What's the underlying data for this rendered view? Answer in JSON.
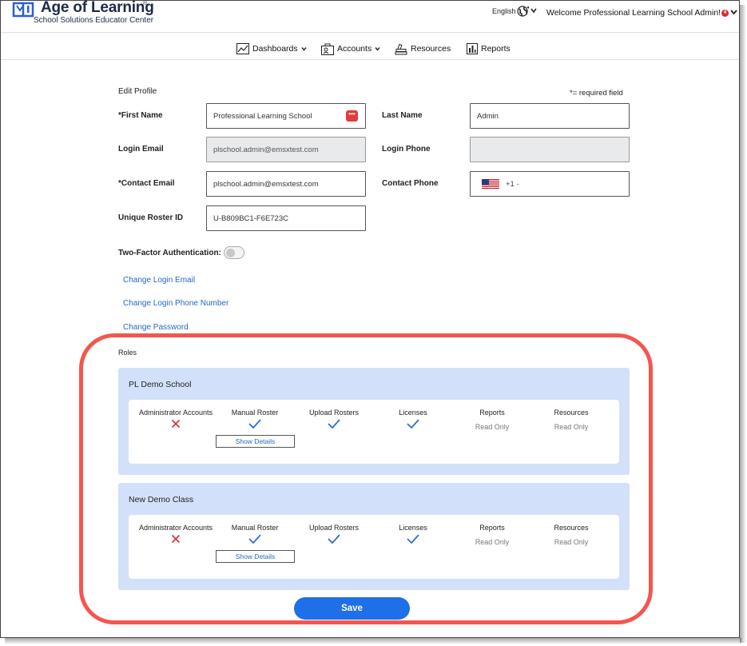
{
  "header": {
    "logo_title": "Age of Learning",
    "logo_reg": "®",
    "logo_subtitle": "School Solutions Educator Center",
    "language": "English",
    "welcome": "Welcome Professional Learning School Admin!",
    "notification_count": "4"
  },
  "nav": {
    "dashboards": "Dashboards",
    "accounts": "Accounts",
    "resources": "Resources",
    "reports": "Reports"
  },
  "profile": {
    "heading": "Edit Profile",
    "required_note": "*= required field",
    "first_name_label": "*First Name",
    "first_name_value": "Professional Learning School",
    "last_name_label": "Last Name",
    "last_name_value": "Admin",
    "login_email_label": "Login Email",
    "login_email_value": "plschool.admin@emsxtest.com",
    "login_phone_label": "Login Phone",
    "login_phone_value": "",
    "contact_email_label": "*Contact Email",
    "contact_email_value": "plschool.admin@emsxtest.com",
    "contact_phone_label": "Contact Phone",
    "contact_phone_code": "+1 -",
    "roster_id_label": "Unique Roster ID",
    "roster_id_value": "U-B809BC1-F6E723C",
    "two_factor_label": "Two-Factor Authentication:",
    "two_factor_enabled": false
  },
  "links": {
    "change_login_email": "Change Login Email",
    "change_login_phone": "Change Login Phone Number",
    "change_password": "Change Password"
  },
  "roles": {
    "heading": "Roles",
    "columns": [
      "Administrator Accounts",
      "Manual Roster",
      "Upload Rosters",
      "Licenses",
      "Reports",
      "Resources"
    ],
    "show_details": "Show Details",
    "entries": [
      {
        "name": "PL Demo School",
        "administrator_accounts": "no",
        "manual_roster": "yes",
        "upload_rosters": "yes",
        "licenses": "yes",
        "reports": "Read Only",
        "resources": "Read Only"
      },
      {
        "name": "New Demo Class",
        "administrator_accounts": "no",
        "manual_roster": "yes",
        "upload_rosters": "yes",
        "licenses": "yes",
        "reports": "Read Only",
        "resources": "Read Only"
      }
    ]
  },
  "actions": {
    "save": "Save"
  },
  "colors": {
    "brand_navy": "#1d2a4b",
    "link_blue": "#2469c4",
    "primary_button": "#1f6fe8",
    "role_background": "#d2e1f9",
    "check_blue": "#2a6fd6",
    "cross_red": "#d9303a",
    "highlight_red": "#f4564e"
  }
}
